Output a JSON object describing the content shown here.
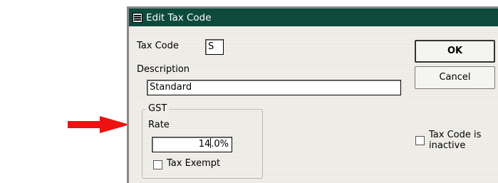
{
  "window": {
    "title": "Edit Tax Code"
  },
  "form": {
    "tax_code_label": "Tax Code",
    "tax_code_value": "S",
    "description_label": "Description",
    "description_value": "Standard",
    "gst_group_label": "GST",
    "rate_label": "Rate",
    "rate_value_before_caret": "14",
    "rate_value_after_caret": ".0%",
    "tax_exempt_label": "Tax Exempt",
    "tax_exempt_checked": false,
    "inactive_label_line1": "Tax Code is",
    "inactive_label_line2": "inactive",
    "inactive_checked": false
  },
  "buttons": {
    "ok_label": "OK",
    "cancel_label": "Cancel"
  },
  "colors": {
    "titlebar": "#0b4a3c",
    "annotation_arrow": "#ee1111"
  },
  "icons": {
    "title_icon": "document-icon",
    "annotation": "red-arrow-icon"
  }
}
